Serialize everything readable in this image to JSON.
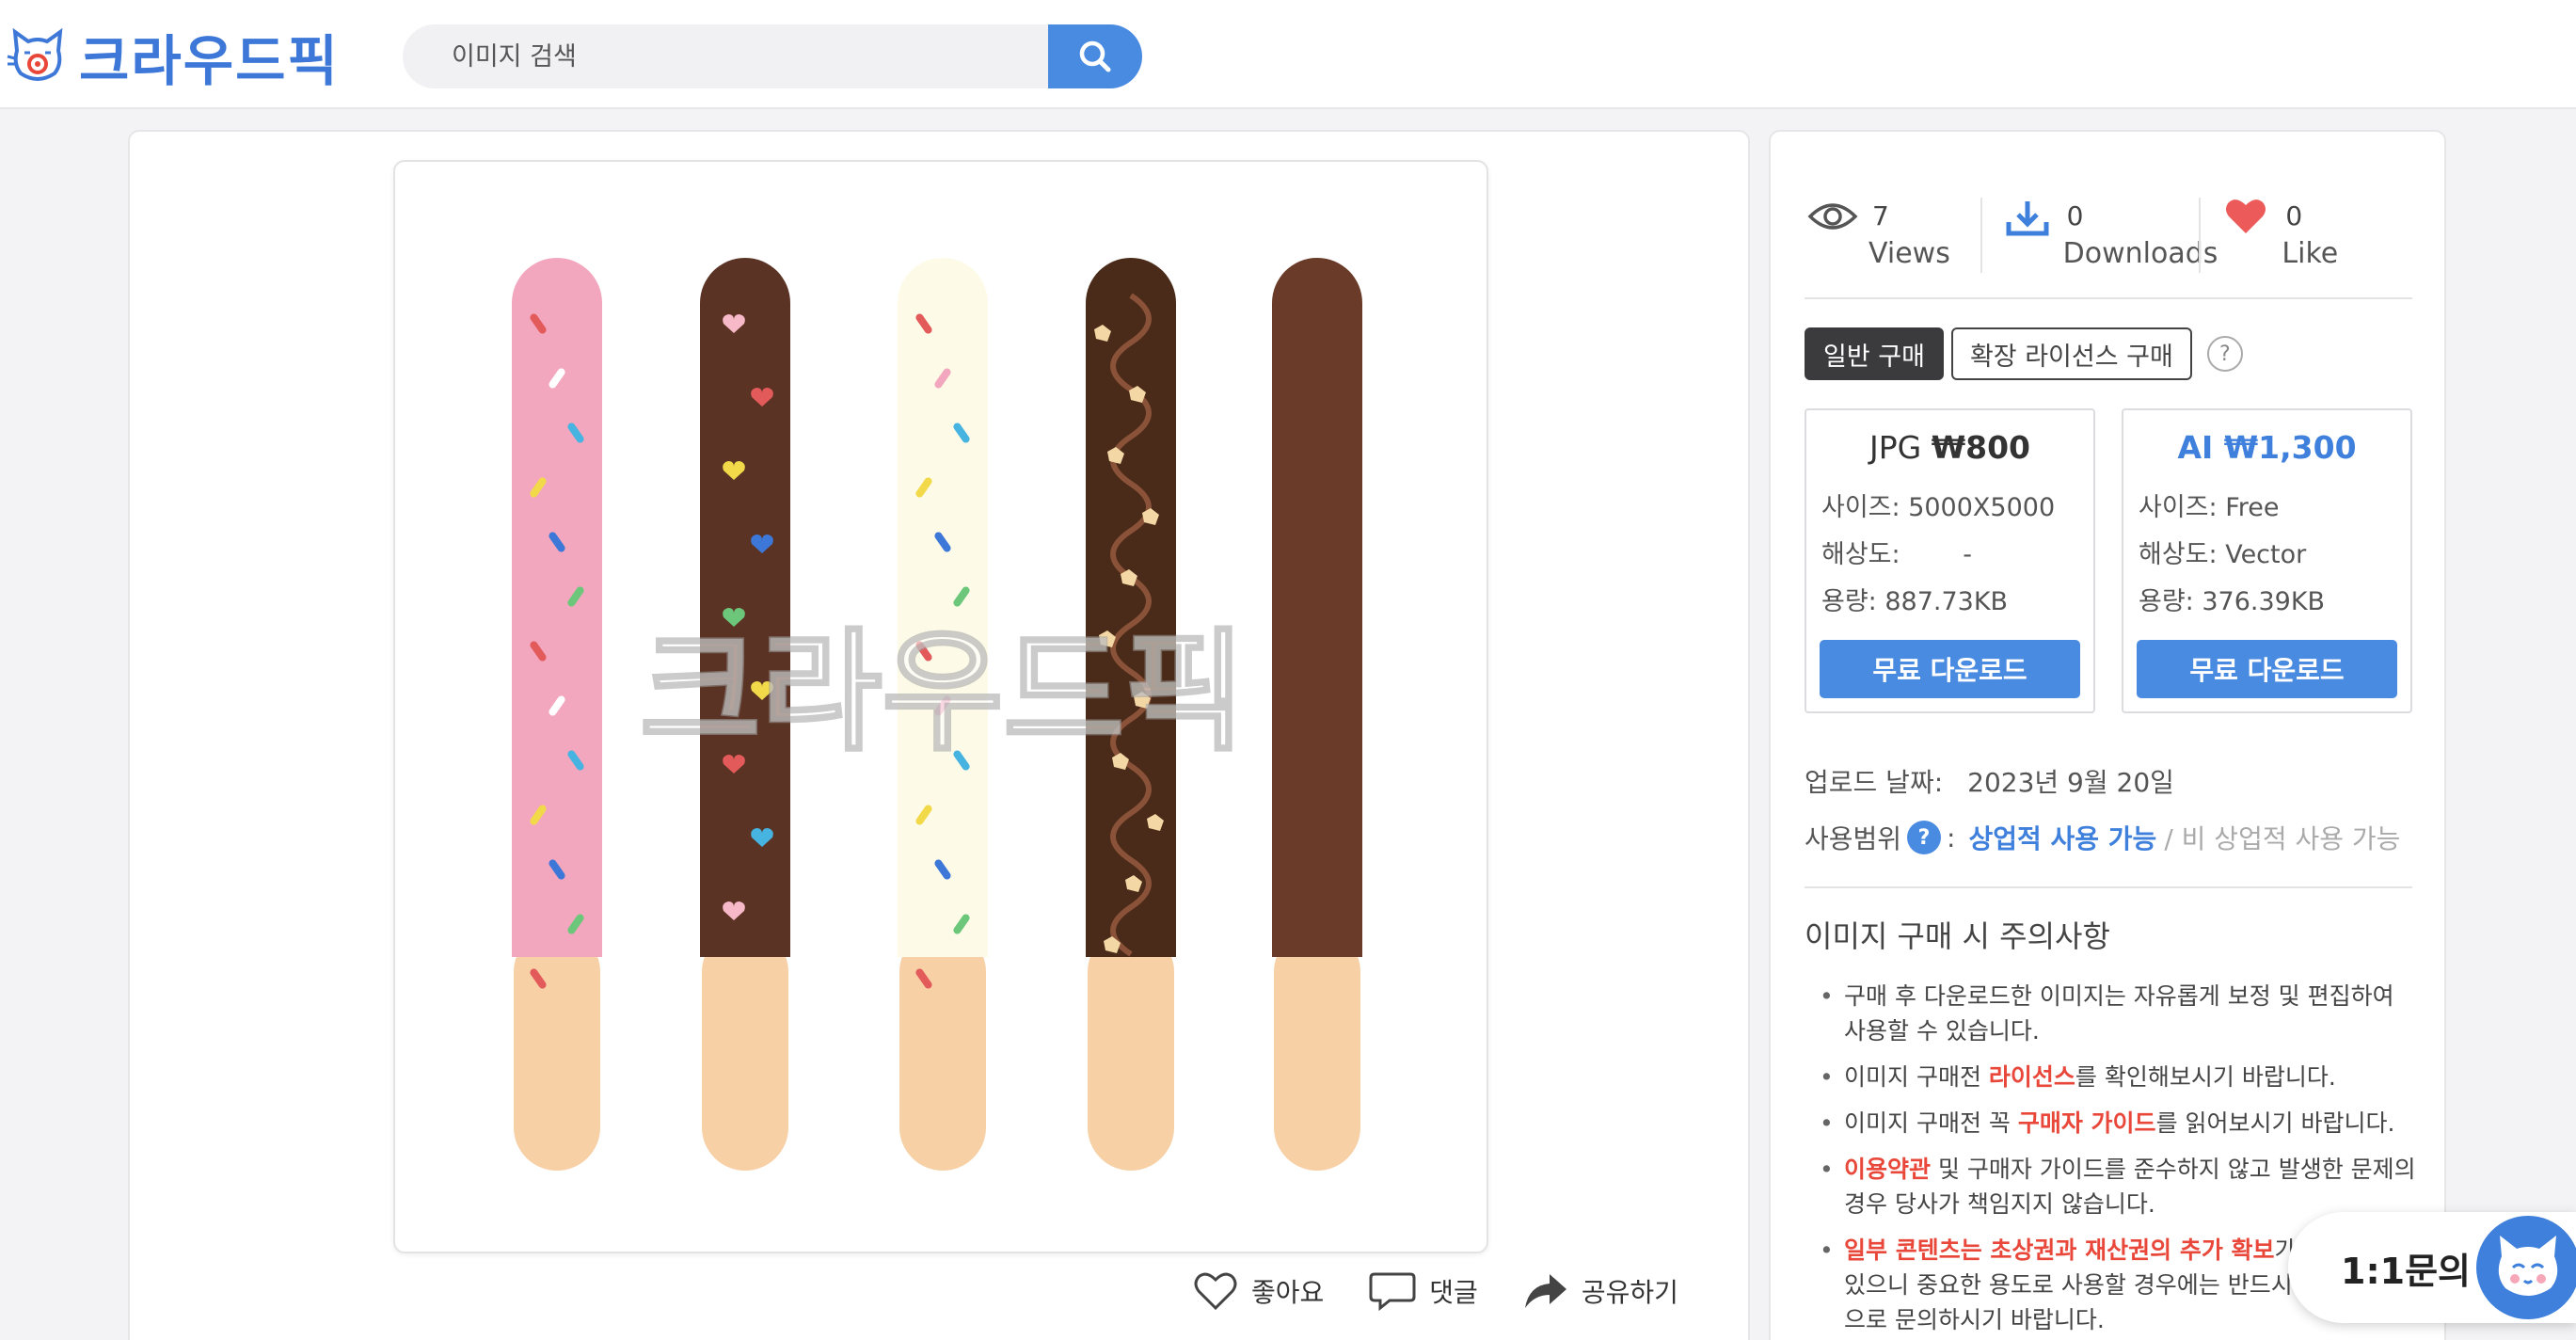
{
  "header": {
    "logo_text": "크라우드픽",
    "search_placeholder": "이미지 검색"
  },
  "colors": {
    "accent": "#4a8be2",
    "brand": "#3d78d8",
    "heart": "#ec5a5a",
    "red_text": "#e8473a"
  },
  "preview": {
    "watermark": "크라우드픽",
    "sticks": [
      {
        "coating": "#f2a7bf",
        "type": "sprinkles"
      },
      {
        "coating": "#5a3324",
        "type": "hearts"
      },
      {
        "coating": "#fdfbe8",
        "type": "sprinkles"
      },
      {
        "coating": "#4a2a18",
        "type": "drizzle"
      },
      {
        "coating": "#6a3b28",
        "type": "plain"
      }
    ]
  },
  "actions": {
    "like": "좋아요",
    "comment": "댓글",
    "share": "공유하기"
  },
  "stats": {
    "views_count": "7",
    "views_label": "Views",
    "downloads_count": "0",
    "downloads_label": "Downloads",
    "likes_count": "0",
    "likes_label": "Like"
  },
  "tabs": {
    "general": "일반 구매",
    "extended": "확장 라이선스 구매",
    "help": "?"
  },
  "jpg": {
    "format": "JPG",
    "price": "₩800",
    "size": "사이즈: 5000X5000",
    "resolution_label": "해상도:",
    "resolution_value": "-",
    "filesize": "용량: 887.73KB",
    "button": "무료 다운로드"
  },
  "ai": {
    "title": "AI ₩1,300",
    "size": "사이즈: Free",
    "resolution": "해상도: Vector",
    "filesize": "용량: 376.39KB",
    "button": "무료 다운로드"
  },
  "meta": {
    "upload_label": "업로드 날짜:",
    "upload_date": "2023년 9월 20일",
    "usage_label": "사용범위",
    "usage_badge": "?",
    "colon": ":",
    "usage_commercial": "상업적 사용 가능",
    "usage_noncommercial": "/ 비 상업적 사용 가능"
  },
  "notice": {
    "title": "이미지 구매 시 주의사항",
    "item1": "구매 후 다운로드한 이미지는 자유롭게 보정 및 편집하여 사용할 수 있습니다.",
    "item2_pre": "이미지 구매전 ",
    "item2_red": "라이선스",
    "item2_post": "를 확인해보시기 바랍니다.",
    "item3_pre": "이미지 구매전 꼭 ",
    "item3_red": "구매자 가이드",
    "item3_post": "를 읽어보시기 바랍니다.",
    "item4_red": "이용약관",
    "item4_post": " 및 구매자 가이드를 준수하지 않고 발생한 문제의 경우 당사가 책임지지 않습니다.",
    "item5_red": "일부 콘텐츠는 초상권과 재산권의 추가 확보",
    "item5_post": "가 필요할 수 있으니 중요한 용도로 사용할 경우에는 반드시 크라우드픽으로 문의하시기 바랍니다."
  },
  "chat": {
    "label": "1:1문의"
  }
}
